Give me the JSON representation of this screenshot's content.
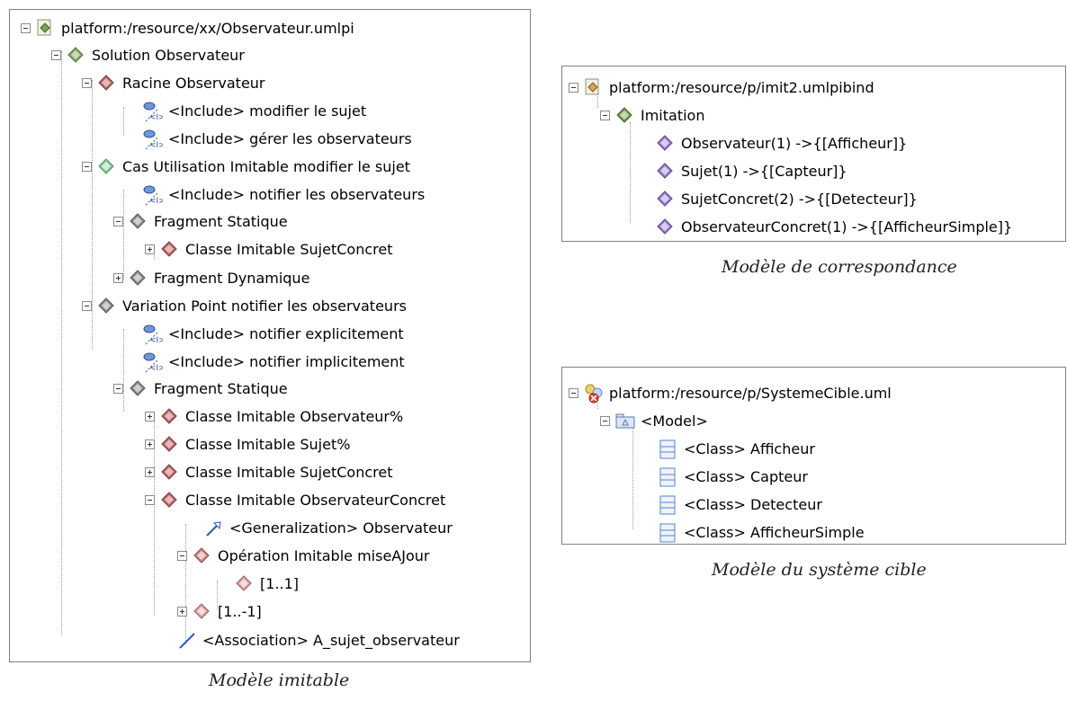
{
  "left_tree": {
    "root": "platform:/resource/xx/Observateur.umlpi",
    "rows": [
      {
        "label": "Solution Observateur"
      },
      {
        "label": "Racine Observateur"
      },
      {
        "label": "<Include> modifier le sujet"
      },
      {
        "label": "<Include> gérer les observateurs"
      },
      {
        "label": "Cas Utilisation Imitable modifier le sujet"
      },
      {
        "label": "<Include> notifier les observateurs"
      },
      {
        "label": "Fragment Statique"
      },
      {
        "label": "Classe Imitable SujetConcret"
      },
      {
        "label": "Fragment Dynamique"
      },
      {
        "label": "Variation Point notifier les observateurs"
      },
      {
        "label": "<Include> notifier explicitement"
      },
      {
        "label": "<Include> notifier implicitement"
      },
      {
        "label": "Fragment Statique"
      },
      {
        "label": "Classe Imitable Observateur%"
      },
      {
        "label": "Classe Imitable Sujet%"
      },
      {
        "label": "Classe Imitable SujetConcret"
      },
      {
        "label": "Classe Imitable ObservateurConcret"
      },
      {
        "label": "<Generalization> Observateur"
      },
      {
        "label": "Opération Imitable miseAJour"
      },
      {
        "label": "[1..1]"
      },
      {
        "label": "[1..-1]"
      },
      {
        "label": "<Association> A_sujet_observateur"
      }
    ],
    "caption": "Modèle imitable"
  },
  "right_top_tree": {
    "root": "platform:/resource/p/imit2.umlpibind",
    "rows": [
      {
        "label": "Imitation"
      },
      {
        "label": "Observateur(1) ->{[Afficheur]}"
      },
      {
        "label": "Sujet(1) ->{[Capteur]}"
      },
      {
        "label": "SujetConcret(2) ->{[Detecteur]}"
      },
      {
        "label": "ObservateurConcret(1) ->{[AfficheurSimple]}"
      }
    ],
    "caption": "Modèle de correspondance"
  },
  "right_bottom_tree": {
    "root": "platform:/resource/p/SystemeCible.uml",
    "rows": [
      {
        "label": "<Model>"
      },
      {
        "label": "<Class> Afficheur"
      },
      {
        "label": "<Class> Capteur"
      },
      {
        "label": "<Class> Detecteur"
      },
      {
        "label": "<Class> AfficheurSimple"
      }
    ],
    "caption": "Modèle du système cible"
  },
  "colors": {
    "diamond_green": "#7aa35a",
    "diamond_red": "#a84d4d",
    "diamond_purple": "#8d6fc1",
    "diamond_gray": "#777777",
    "include_blue": "#3b67c2",
    "class_blue": "#5a83c8"
  }
}
